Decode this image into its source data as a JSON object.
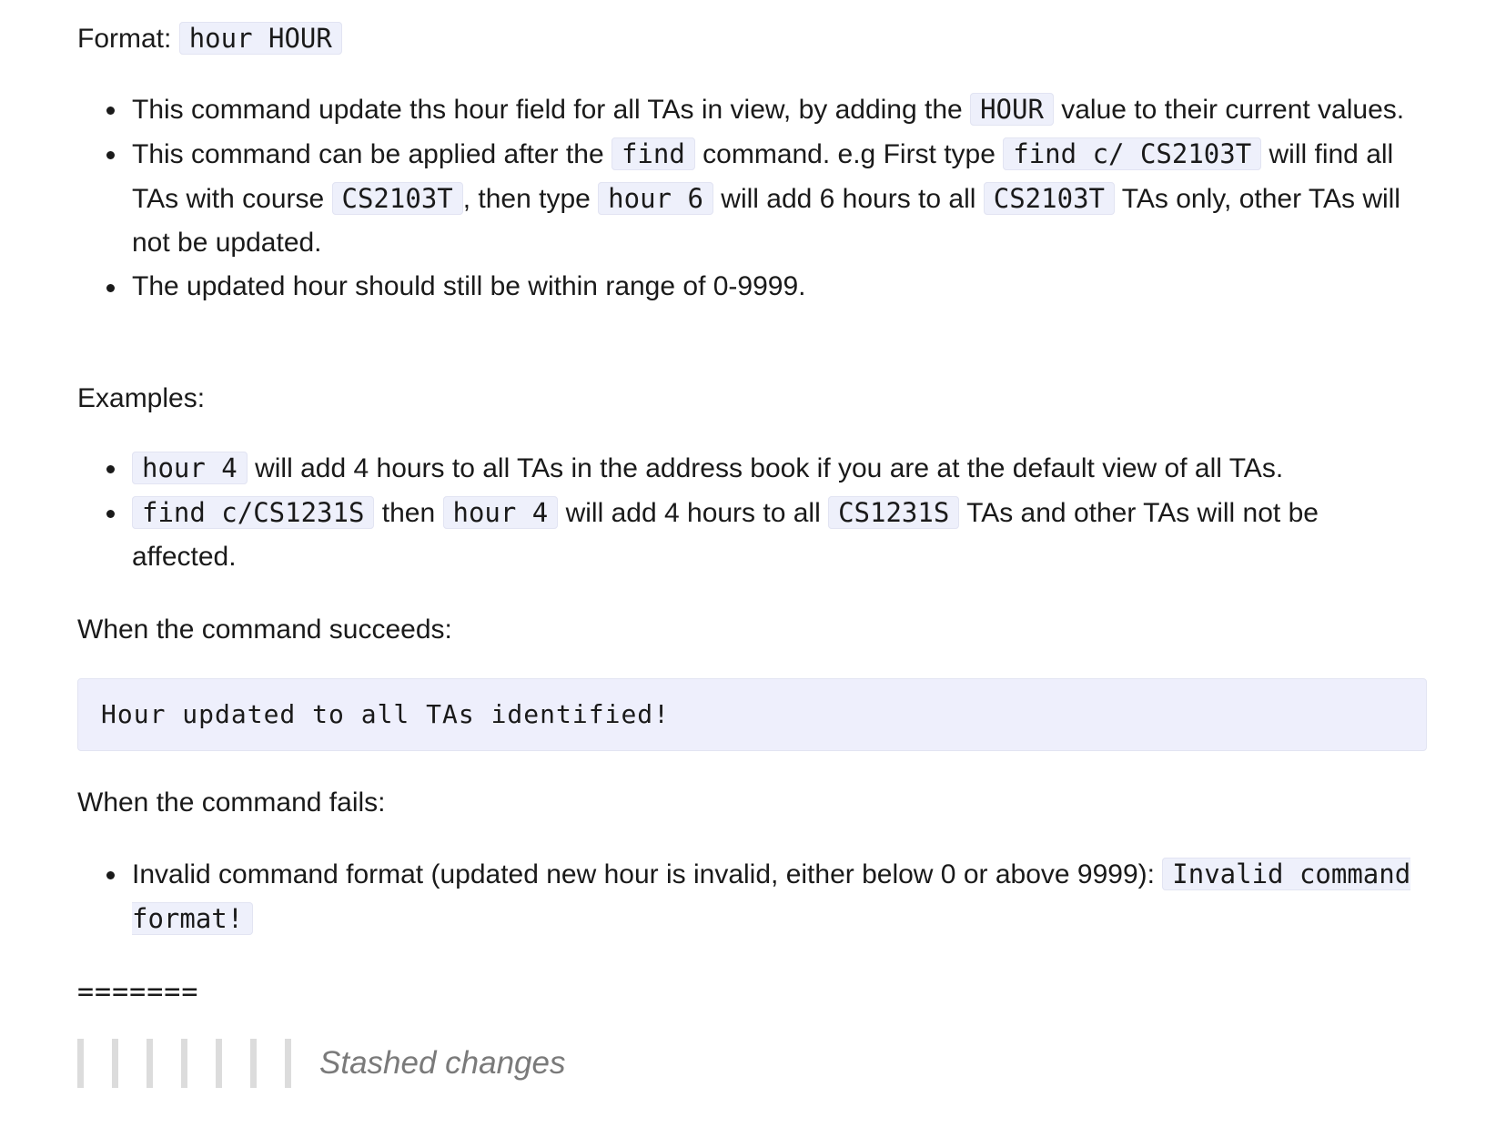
{
  "format": {
    "label": "Format:",
    "code": "hour HOUR"
  },
  "notes": [
    {
      "t1": "This command update ths hour field for all TAs in view, by adding the ",
      "c1": "HOUR",
      "t2": " value to their current values."
    },
    {
      "t1": "This command can be applied after the ",
      "c1": "find",
      "t2": " command. e.g First type ",
      "c2": "find c/ CS2103T",
      "t3": " will find all TAs with course ",
      "c3": "CS2103T",
      "t4": ", then type ",
      "c4": "hour 6",
      "t5": " will add 6 hours to all ",
      "c5": "CS2103T",
      "t6": " TAs only, other TAs will not be updated."
    },
    {
      "t1": "The updated hour should still be within range of 0-9999."
    }
  ],
  "examples": {
    "label": "Examples:",
    "items": [
      {
        "c1": "hour 4",
        "t1": " will add 4 hours to all TAs in the address book if you are at the default view of all TAs."
      },
      {
        "c1": "find c/CS1231S",
        "t1": " then ",
        "c2": "hour 4",
        "t2": " will add 4 hours to all ",
        "c3": "CS1231S",
        "t3": " TAs and other TAs will not be affected."
      }
    ]
  },
  "success": {
    "label": "When the command succeeds:",
    "message": "Hour updated to all TAs identified!"
  },
  "failure": {
    "label": "When the command fails:",
    "items": [
      {
        "t1": "Invalid command format (updated new hour is invalid, either below 0 or above 9999): ",
        "c1": "Invalid command format!"
      }
    ]
  },
  "merge_marker": "=======",
  "stash": {
    "text": "Stashed changes"
  }
}
